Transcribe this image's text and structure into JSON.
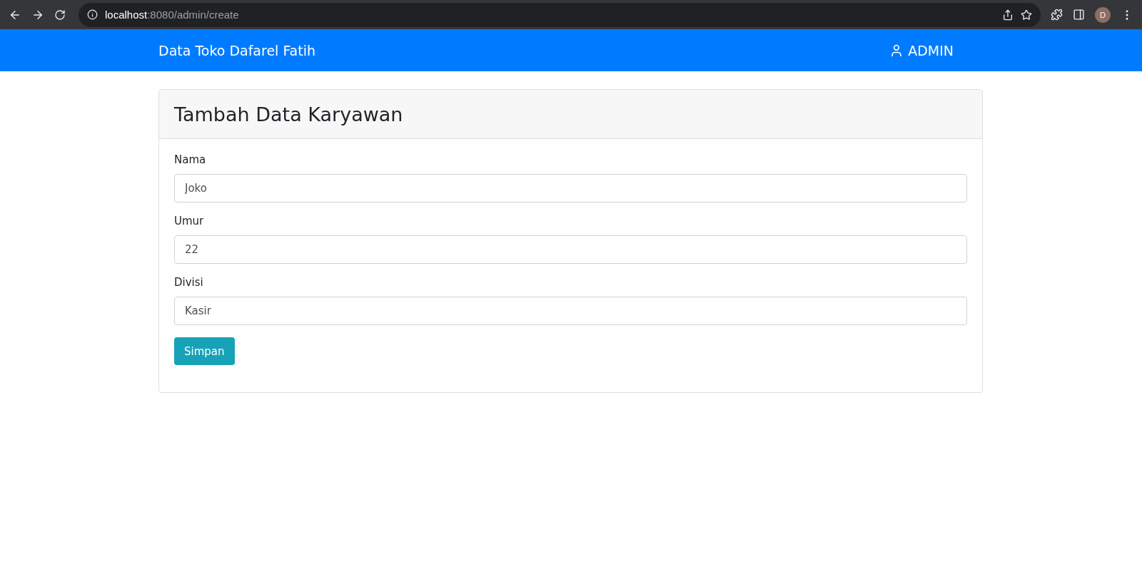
{
  "browser": {
    "url": "**localhost**:8080/admin/create",
    "profile_initial": "D"
  },
  "navbar": {
    "brand": "Data Toko Dafarel Fatih",
    "user": "ADMIN"
  },
  "card": {
    "title": "Tambah Data Karyawan",
    "fields": [
      {
        "label": "Nama",
        "value": "Joko"
      },
      {
        "label": "Umur",
        "value": "22"
      },
      {
        "label": "Divisi",
        "value": "Kasir"
      }
    ],
    "submit": "Simpan"
  }
}
